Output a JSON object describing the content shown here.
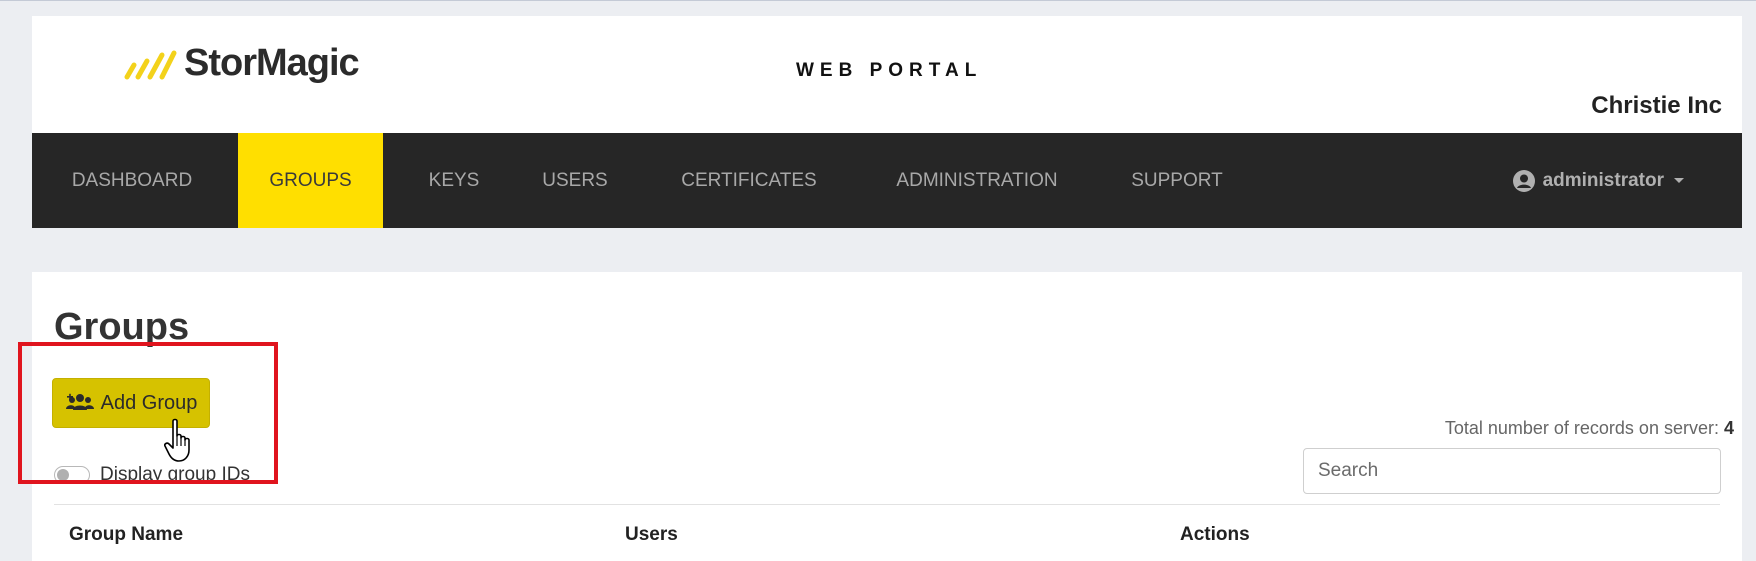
{
  "header": {
    "brand": "StorMagic",
    "portal_title": "WEB PORTAL",
    "company": "Christie Inc"
  },
  "nav": {
    "items": [
      {
        "label": "DASHBOARD",
        "active": false
      },
      {
        "label": "GROUPS",
        "active": true
      },
      {
        "label": "KEYS",
        "active": false
      },
      {
        "label": "USERS",
        "active": false
      },
      {
        "label": "CERTIFICATES",
        "active": false
      },
      {
        "label": "ADMINISTRATION",
        "active": false
      },
      {
        "label": "SUPPORT",
        "active": false
      }
    ],
    "user": "administrator"
  },
  "main": {
    "title": "Groups",
    "add_button": "Add Group",
    "toggle_label": "Display group IDs",
    "total_label": "Total number of records on server:",
    "total_count": "4",
    "search_placeholder": "Search",
    "columns": [
      "Group Name",
      "Users",
      "Actions"
    ]
  },
  "colors": {
    "accent": "#ffdf00",
    "nav_bg": "#262626",
    "button": "#d6c200",
    "highlight": "#e0141e"
  }
}
